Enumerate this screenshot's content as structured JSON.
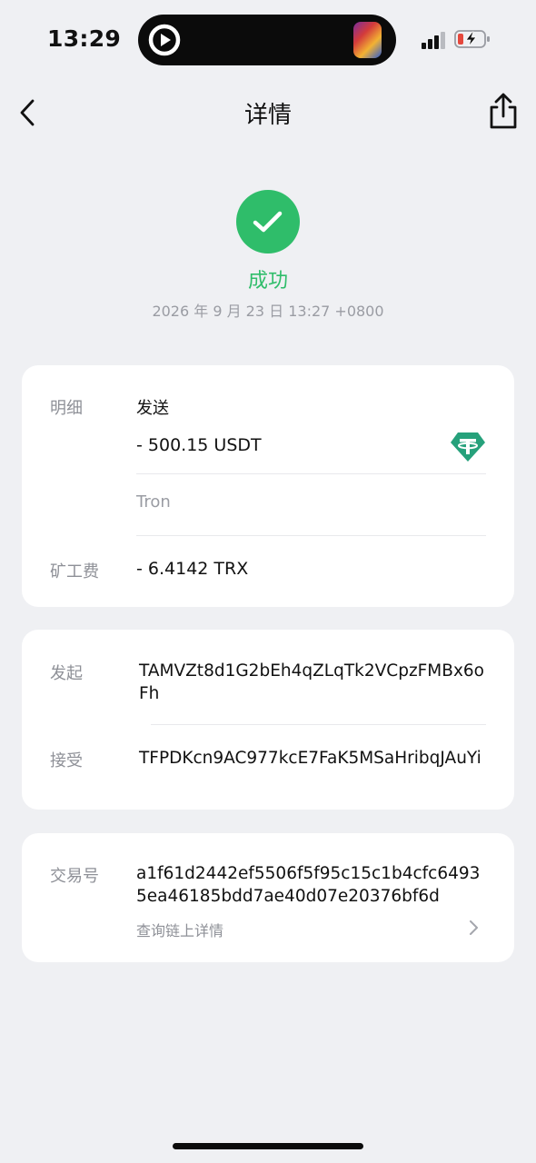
{
  "status_bar": {
    "time": "13:29"
  },
  "nav": {
    "title": "详情"
  },
  "status": {
    "text": "成功",
    "datetime": "2026 年 9 月 23 日 13:27 +0800"
  },
  "details_card": {
    "label": "明细",
    "type": "发送",
    "amount": "- 500.15 USDT",
    "network": "Tron",
    "fee_label": "矿工费",
    "fee": "- 6.4142 TRX",
    "token_icon": "tether-usdt-icon"
  },
  "address_card": {
    "from_label": "发起",
    "from_address": "TAMVZt8d1G2bEh4qZLqTk2VCpzFMBx6oFh",
    "to_label": "接受",
    "to_address": "TFPDKcn9AC977kcE7FaK5MSaHribqJAuYi"
  },
  "tx_card": {
    "label": "交易号",
    "hash": "a1f61d2442ef5506f5f95c15c1b4cfc64935ea46185bdd7ae40d07e20376bf6d",
    "link_label": "查询链上详情"
  },
  "colors": {
    "success": "#2fbd6a",
    "tether": "#26a17b",
    "background": "#eff0f3"
  }
}
